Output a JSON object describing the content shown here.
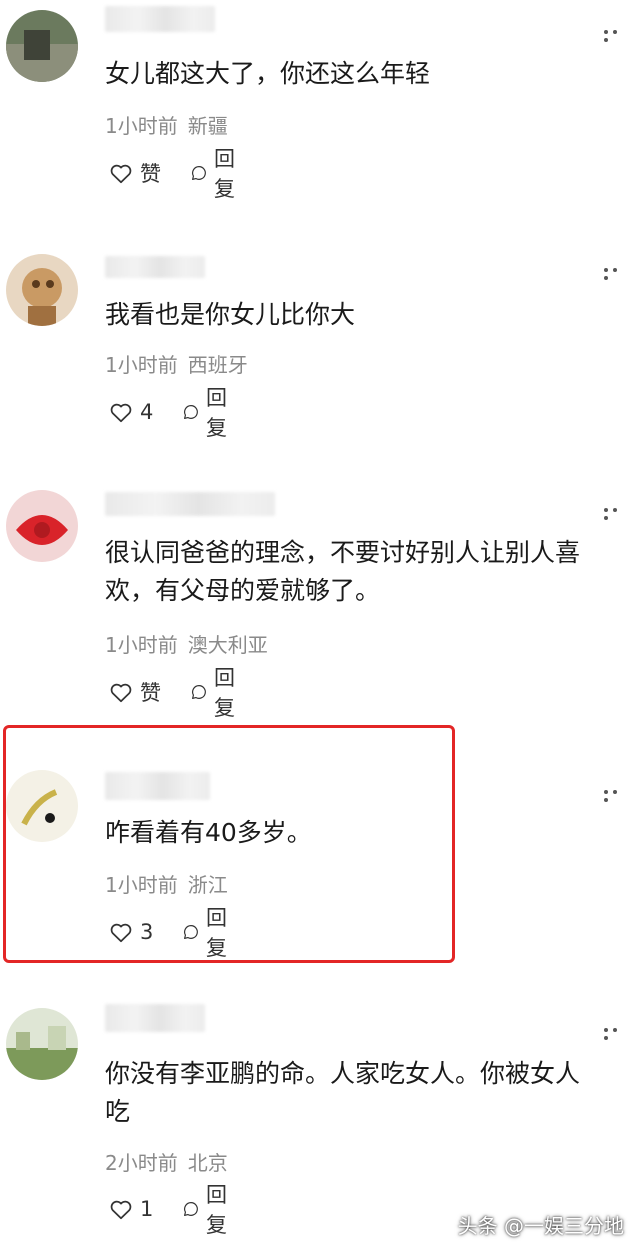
{
  "comments": [
    {
      "text": "女儿都这大了，你还这么年轻",
      "time": "1小时前",
      "location": "新疆",
      "like_label": "赞",
      "reply_label": "回复"
    },
    {
      "text": "我看也是你女儿比你大",
      "time": "1小时前",
      "location": "西班牙",
      "like_label": "4",
      "reply_label": "回复"
    },
    {
      "text_line1": "很认同爸爸的理念，不要讨好别人让别人喜",
      "text_line2": "欢，有父母的爱就够了。",
      "time": "1小时前",
      "location": "澳大利亚",
      "like_label": "赞",
      "reply_label": "回复"
    },
    {
      "text": "咋看着有40多岁。",
      "time": "1小时前",
      "location": "浙江",
      "like_label": "3",
      "reply_label": "回复"
    },
    {
      "text_line1": "你没有李亚鹏的命。人家吃女人。你被女人",
      "text_line2": "吃",
      "time": "2小时前",
      "location": "北京",
      "like_label": "1",
      "reply_label": "回复"
    }
  ],
  "watermark": "头条 @一娱三分地",
  "colors": {
    "highlight": "#e32626",
    "meta": "#8a8a8a"
  },
  "icons": [
    "heart-outline-icon",
    "speech-bubble-icon",
    "more-dots-icon"
  ]
}
